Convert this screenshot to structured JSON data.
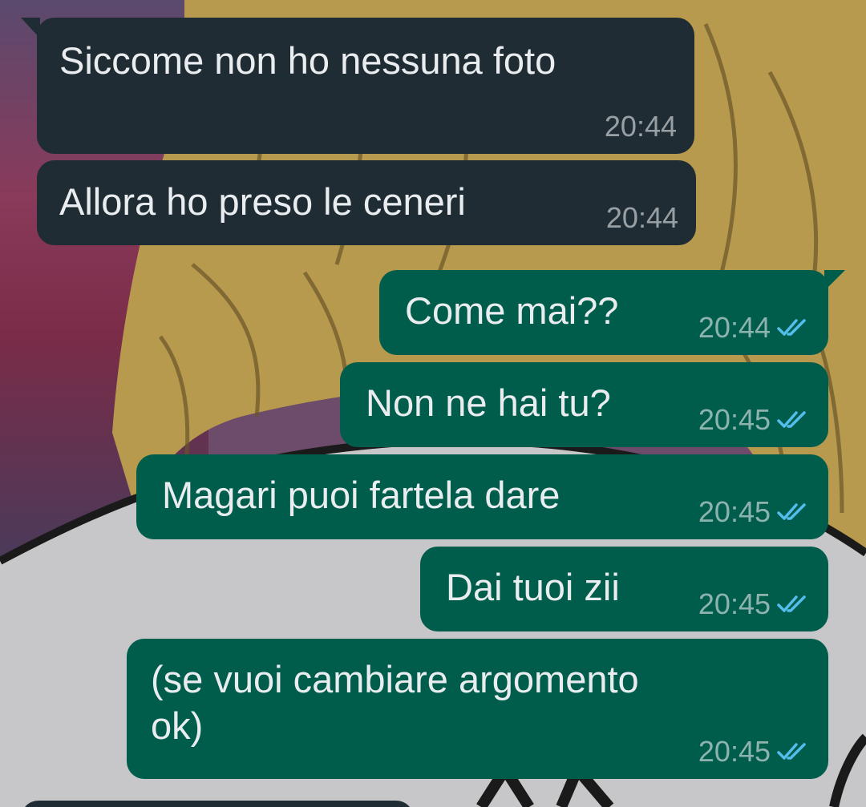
{
  "colors": {
    "incoming_bubble": "#202c33",
    "outgoing_bubble": "#005c4b",
    "text": "#e9edef",
    "read_ticks": "#53bdeb"
  },
  "messages": [
    {
      "direction": "incoming",
      "text": "Siccome non ho nessuna foto",
      "time": "20:44"
    },
    {
      "direction": "incoming",
      "text": "Allora ho preso le ceneri",
      "time": "20:44"
    },
    {
      "direction": "outgoing",
      "text": "Come mai??",
      "time": "20:44",
      "status_icon": "double-check-read-icon"
    },
    {
      "direction": "outgoing",
      "text": "Non ne hai tu?",
      "time": "20:45",
      "status_icon": "double-check-read-icon"
    },
    {
      "direction": "outgoing",
      "text": "Magari puoi fartela dare",
      "time": "20:45",
      "status_icon": "double-check-read-icon"
    },
    {
      "direction": "outgoing",
      "text": "Dai tuoi zii",
      "time": "20:45",
      "status_icon": "double-check-read-icon"
    },
    {
      "direction": "outgoing",
      "text": "(se vuoi cambiare argomento\nok)",
      "time": "20:45",
      "status_icon": "double-check-read-icon"
    }
  ]
}
